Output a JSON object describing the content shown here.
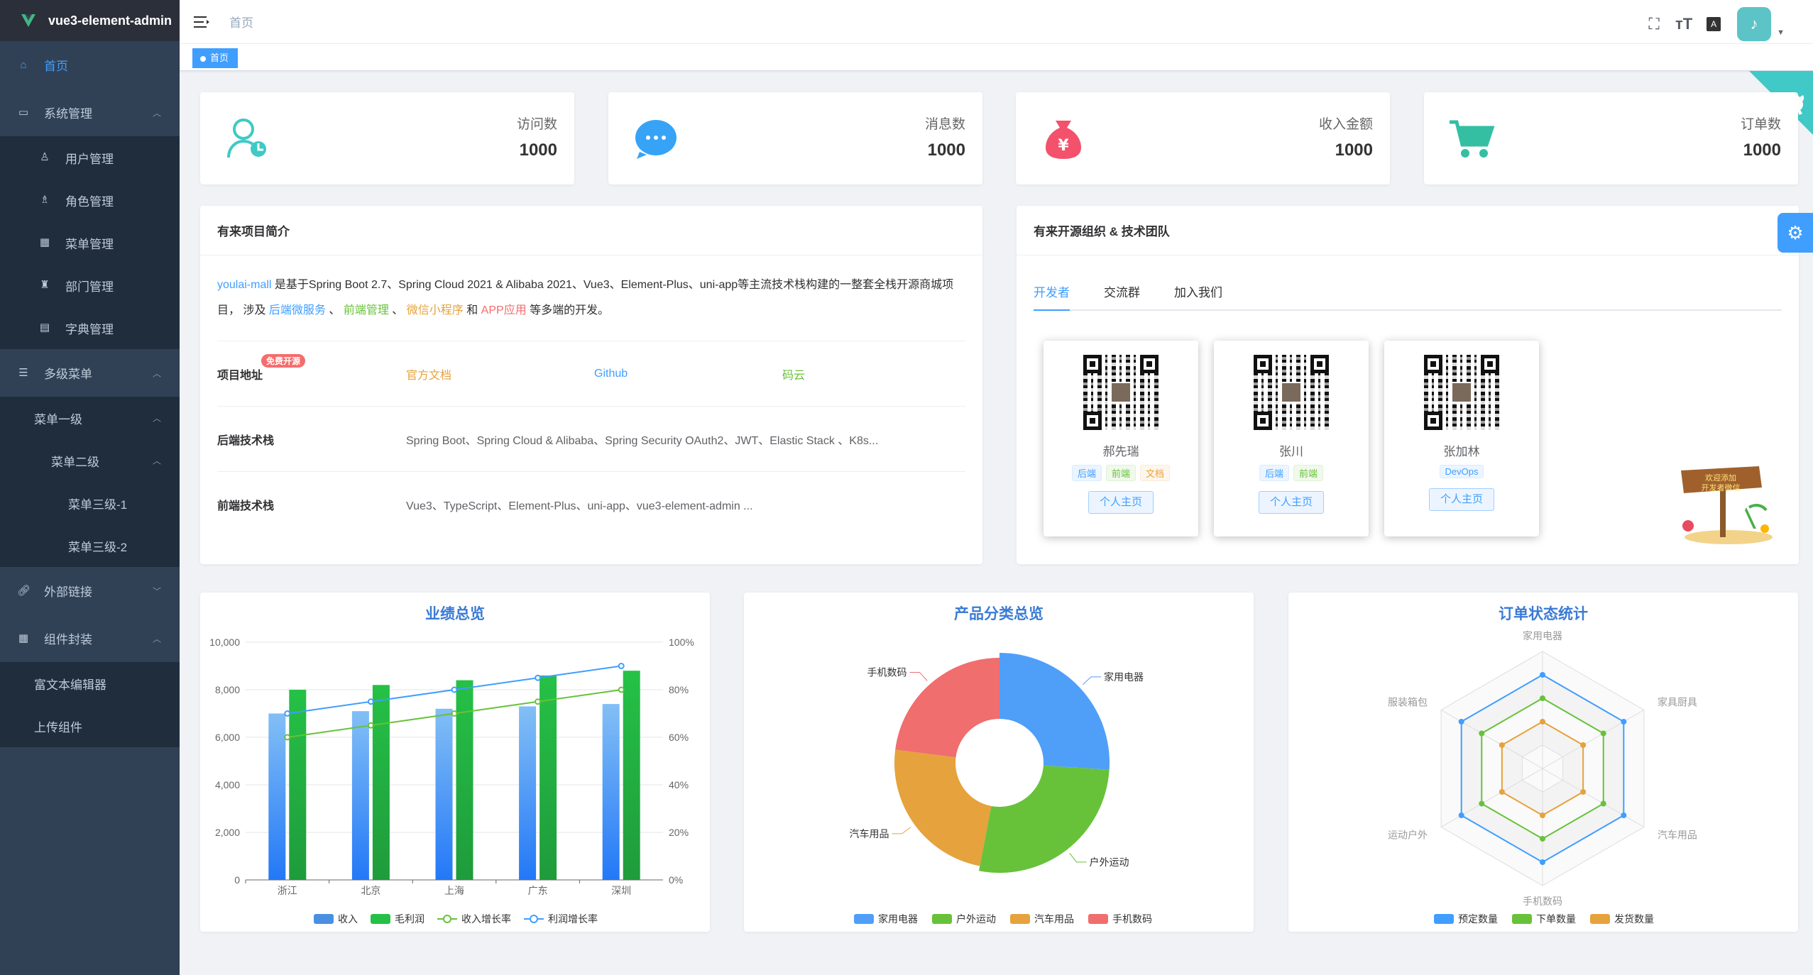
{
  "app": {
    "title": "vue3-element-admin"
  },
  "sidebar": {
    "home": "首页",
    "system": "系统管理",
    "system_items": [
      "用户管理",
      "角色管理",
      "菜单管理",
      "部门管理",
      "字典管理"
    ],
    "multi": "多级菜单",
    "level1": "菜单一级",
    "level2": "菜单二级",
    "level3": [
      "菜单三级-1",
      "菜单三级-2"
    ],
    "external": "外部链接",
    "components": "组件封装",
    "component_items": [
      "富文本编辑器",
      "上传组件"
    ]
  },
  "navbar": {
    "breadcrumb": "首页",
    "icons": [
      "fullscreen-icon",
      "font-size-icon",
      "language-icon"
    ]
  },
  "tags": {
    "active": "首页"
  },
  "stats": [
    {
      "label": "访问数",
      "value": "1000",
      "icon": "user-icon",
      "color": "#40c9c6"
    },
    {
      "label": "消息数",
      "value": "1000",
      "icon": "message-icon",
      "color": "#36a3f7"
    },
    {
      "label": "收入金额",
      "value": "1000",
      "icon": "money-bag-icon",
      "color": "#f4516c"
    },
    {
      "label": "订单数",
      "value": "1000",
      "icon": "cart-icon",
      "color": "#34bfa3"
    }
  ],
  "intro": {
    "title": "有来项目简介",
    "p1_link": "youlai-mall",
    "p1_text": " 是基于Spring Boot 2.7、Spring Cloud 2021 & Alibaba 2021、Vue3、Element-Plus、uni-app等主流技术栈构建的一整套全栈开源商城项目， 涉及 ",
    "l_backend": "后端微服务",
    "sep1": " 、 ",
    "l_front": "前端管理",
    "sep2": " 、 ",
    "l_mini": "微信小程序",
    "and": " 和 ",
    "l_app": "APP应用",
    "tail": " 等多端的开发。",
    "addr_label": "项目地址",
    "addr_badge": "免费开源",
    "addr_links": [
      "官方文档",
      "Github",
      "码云"
    ],
    "backend_label": "后端技术栈",
    "backend_value": "Spring Boot、Spring Cloud & Alibaba、Spring Security OAuth2、JWT、Elastic Stack 、K8s...",
    "frontend_label": "前端技术栈",
    "frontend_value": "Vue3、TypeScript、Element-Plus、uni-app、vue3-element-admin ..."
  },
  "team": {
    "title": "有来开源组织 & 技术团队",
    "tabs": [
      "开发者",
      "交流群",
      "加入我们"
    ],
    "devs": [
      {
        "name": "郝先瑞",
        "tags": [
          "后端",
          "前端",
          "文档"
        ],
        "btn": "个人主页"
      },
      {
        "name": "张川",
        "tags": [
          "后端",
          "前端"
        ],
        "btn": "个人主页"
      },
      {
        "name": "张加林",
        "tags": [
          "DevOps"
        ],
        "btn": "个人主页"
      }
    ],
    "sign": "欢迎添加\n开发者微信"
  },
  "charts": {
    "bar": {
      "title": "业绩总览",
      "legend": [
        "收入",
        "毛利润",
        "收入增长率",
        "利润增长率"
      ]
    },
    "pie": {
      "title": "产品分类总览",
      "legend": [
        "家用电器",
        "户外运动",
        "汽车用品",
        "手机数码"
      ]
    },
    "radar": {
      "title": "订单状态统计",
      "legend": [
        "预定数量",
        "下单数量",
        "发货数量"
      ]
    }
  },
  "chart_data": [
    {
      "type": "bar",
      "title": "业绩总览",
      "categories": [
        "浙江",
        "北京",
        "上海",
        "广东",
        "深圳"
      ],
      "ylim": [
        0,
        10000
      ],
      "y_ticks": [
        "10,000",
        "8,000",
        "6,000",
        "4,000",
        "2,000",
        "0"
      ],
      "y2lim": [
        0,
        100
      ],
      "y2_ticks": [
        "100%",
        "80%",
        "60%",
        "40%",
        "20%",
        "0%"
      ],
      "series": [
        {
          "name": "收入",
          "kind": "bar",
          "values": [
            7000,
            7100,
            7200,
            7300,
            7400
          ],
          "color": "#4a90e2"
        },
        {
          "name": "毛利润",
          "kind": "bar",
          "values": [
            8000,
            8200,
            8400,
            8600,
            8800
          ],
          "color": "#25c146"
        },
        {
          "name": "收入增长率",
          "kind": "line",
          "axis": "right",
          "values": [
            60,
            65,
            70,
            75,
            80
          ],
          "color": "#67c23a"
        },
        {
          "name": "利润增长率",
          "kind": "line",
          "axis": "right",
          "values": [
            70,
            75,
            80,
            85,
            90
          ],
          "color": "#409eff"
        }
      ]
    },
    {
      "type": "pie",
      "title": "产品分类总览",
      "categories": [
        "家用电器",
        "户外运动",
        "汽车用品",
        "手机数码"
      ],
      "values": [
        26,
        27,
        24,
        23
      ],
      "colors": [
        "#4f9ff8",
        "#67c23a",
        "#e6a23c",
        "#f06e6e"
      ]
    },
    {
      "type": "radar",
      "title": "订单状态统计",
      "indicators": [
        "家用电器",
        "家具厨具",
        "汽车用品",
        "手机数码",
        "运动户外",
        "服装箱包"
      ],
      "max": 100,
      "series": [
        {
          "name": "预定数量",
          "values": [
            80,
            80,
            80,
            80,
            80,
            80
          ],
          "color": "#409eff"
        },
        {
          "name": "下单数量",
          "values": [
            60,
            60,
            60,
            60,
            60,
            60
          ],
          "color": "#67c23a"
        },
        {
          "name": "发货数量",
          "values": [
            40,
            40,
            40,
            40,
            40,
            40
          ],
          "color": "#e6a23c"
        }
      ]
    }
  ]
}
